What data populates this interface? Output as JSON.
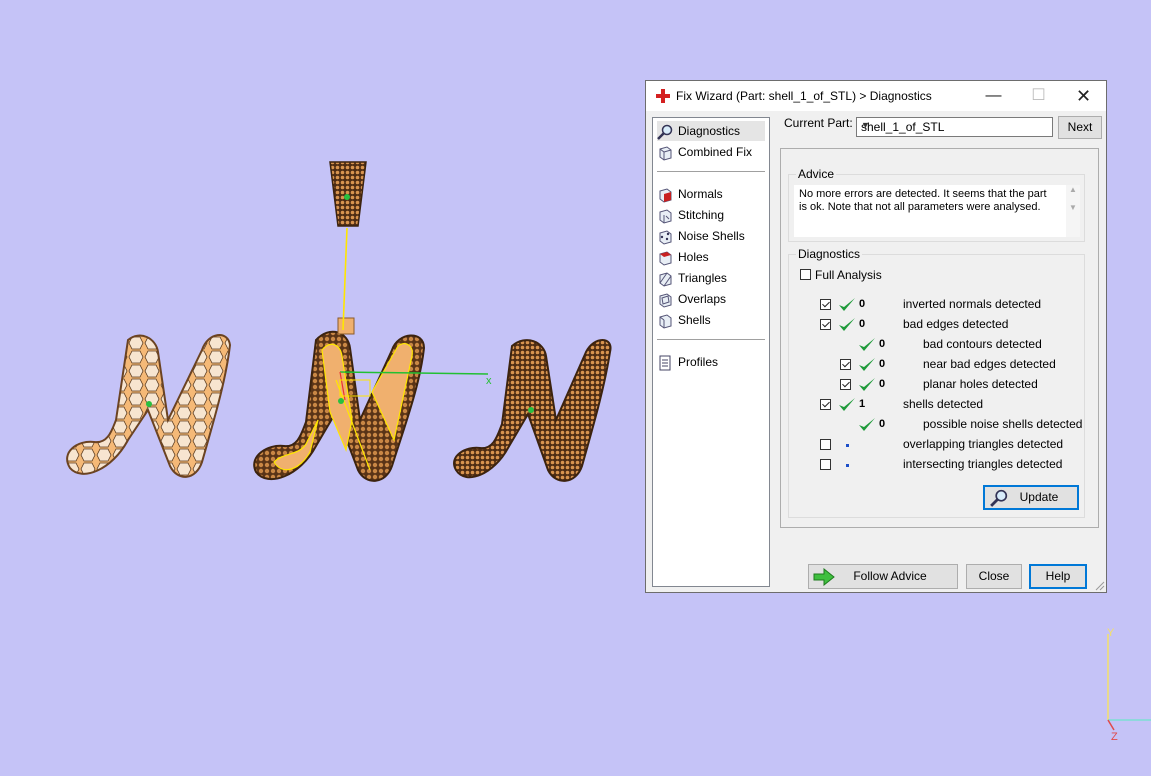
{
  "window": {
    "title": "Fix Wizard (Part: shell_1_of_STL) > Diagnostics",
    "minimize": "—",
    "maximize": "☐",
    "close": "✕"
  },
  "nav": {
    "items": [
      {
        "label": "Diagnostics",
        "icon": "magnifier-icon",
        "active": true
      },
      {
        "label": "Combined Fix",
        "icon": "cube-icon"
      },
      {
        "label": "Normals",
        "icon": "normals-cube-icon"
      },
      {
        "label": "Stitching",
        "icon": "stitching-cube-icon"
      },
      {
        "label": "Noise Shells",
        "icon": "noise-shells-icon"
      },
      {
        "label": "Holes",
        "icon": "holes-cube-icon"
      },
      {
        "label": "Triangles",
        "icon": "triangles-cube-icon"
      },
      {
        "label": "Overlaps",
        "icon": "overlaps-cube-icon"
      },
      {
        "label": "Shells",
        "icon": "shells-cube-icon"
      },
      {
        "label": "Profiles",
        "icon": "document-icon"
      }
    ]
  },
  "part": {
    "label": "Current Part:",
    "value": "shell_1_of_STL",
    "next": "Next"
  },
  "advice": {
    "title": "Advice",
    "text": "No more errors are detected. It seems that the part is ok. Note that not all parameters were analysed."
  },
  "diagnostics": {
    "title": "Diagnostics",
    "full_analysis": "Full Analysis",
    "rows": [
      {
        "checkbox": "checked",
        "status": "ok",
        "count": "0",
        "label": "inverted normals detected"
      },
      {
        "checkbox": "checked",
        "status": "ok",
        "count": "0",
        "label": "bad edges detected"
      },
      {
        "checkbox": "none",
        "status": "ok",
        "count": "0",
        "label": "bad contours detected"
      },
      {
        "checkbox": "checked",
        "status": "ok",
        "count": "0",
        "label": "near bad edges detected"
      },
      {
        "checkbox": "checked",
        "status": "ok",
        "count": "0",
        "label": "planar holes detected"
      },
      {
        "checkbox": "checked",
        "status": "ok",
        "count": "1",
        "label": "shells detected"
      },
      {
        "checkbox": "none",
        "status": "ok",
        "count": "0",
        "label": "possible noise shells detected"
      },
      {
        "checkbox": "unchecked",
        "status": "pending",
        "count": "",
        "label": "overlapping triangles detected"
      },
      {
        "checkbox": "unchecked",
        "status": "pending",
        "count": "",
        "label": "intersecting triangles detected"
      }
    ],
    "update": "Update"
  },
  "buttons": {
    "follow_advice": "Follow Advice",
    "close": "Close",
    "help": "Help"
  },
  "viewport": {
    "axis_x": "x",
    "axis_y": "Y",
    "axis_z": "Z",
    "background": "#c5c3f7",
    "part_color": "#f2b06b",
    "part_dark": "#7a4a26",
    "selection": "#ffe600",
    "axis_green": "#22c032"
  }
}
